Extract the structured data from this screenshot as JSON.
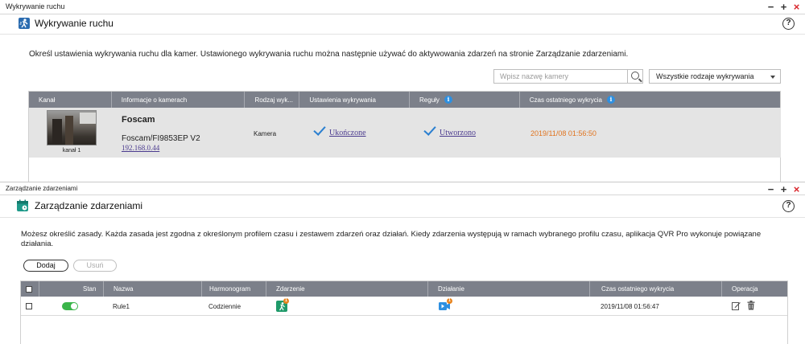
{
  "motion_window": {
    "titlebar": "Wykrywanie ruchu",
    "title": "Wykrywanie ruchu",
    "help": "?",
    "description": "Określ ustawienia wykrywania ruchu dla kamer. Ustawionego wykrywania ruchu można następnie używać do aktywowania zdarzeń na stronie Zarządzanie zdarzeniami.",
    "search_placeholder": "Wpisz nazwę kamery",
    "filter_value": "Wszystkie rodzaje wykrywania",
    "columns": [
      "Kanał",
      "Informacje o kamerach",
      "Rodzaj wyk...",
      "Ustawienia wykrywania",
      "Reguły",
      "Czas ostatniego wykrycia"
    ],
    "rows": [
      {
        "channel": "kanał 1",
        "camera_name": "Foscam",
        "camera_model": "Foscam/FI9853EP V2",
        "camera_ip": "192.168.0.44",
        "detection_type": "Kamera",
        "settings_status": "Ukończone",
        "rules_status": "Utworzono",
        "last_detection": "2019/11/08 01:56:50"
      }
    ]
  },
  "event_window": {
    "titlebar": "Zarządzanie zdarzeniami",
    "title": "Zarządzanie zdarzeniami",
    "help": "?",
    "description_line1": "Możesz określić zasady. Każda zasada jest zgodna z określonym profilem czasu i zestawem zdarzeń oraz działań. Kiedy zdarzenia występują w ramach wybranego profilu czasu, aplikacja QVR Pro wykonuje powiązane",
    "description_line2": "działania.",
    "add_button": "Dodaj",
    "delete_button": "Usuń",
    "columns": [
      "Stan",
      "Nazwa",
      "Harmonogram",
      "Zdarzenie",
      "Działanie",
      "Czas ostatniego wykrycia",
      "Operacja"
    ],
    "rows": [
      {
        "state": "on",
        "name": "Rule1",
        "schedule": "Codziennie",
        "event_count": "1",
        "action_count": "1",
        "last_detection": "2019/11/08 01:56:47"
      }
    ]
  },
  "window_controls": {
    "minimize": "−",
    "maximize": "+",
    "close": "×"
  },
  "colors": {
    "header_bg": "#7c808a",
    "accent_blue": "#2e8fe0",
    "time_orange": "#e0741f",
    "toggle_green": "#3ab54a",
    "close_red": "#d9262c"
  }
}
